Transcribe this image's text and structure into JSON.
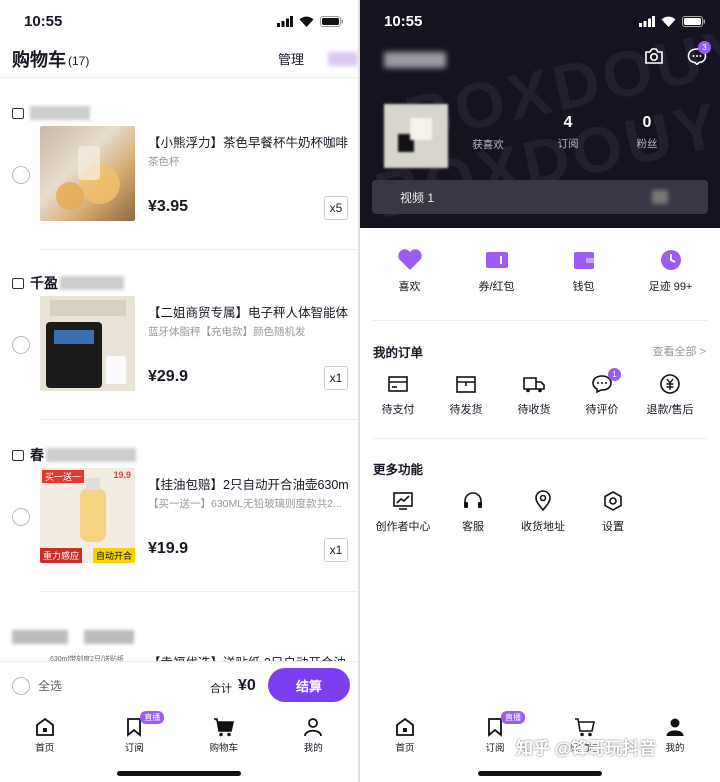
{
  "left": {
    "status": {
      "time": "10:55"
    },
    "header": {
      "title": "购物车",
      "count": "(17)",
      "manage": "管理"
    },
    "shops": [
      {
        "name": "",
        "items": [
          {
            "title": "【小熊浮力】茶色早餐杯牛奶杯咖啡",
            "spec": "茶色杯",
            "price": "¥3.95",
            "qty": "x5"
          }
        ]
      },
      {
        "name": "千盈",
        "items": [
          {
            "title": "【二姐商贸专属】电子秤人体智能体",
            "spec": "蓝牙体脂秤【充电款】颜色随机发",
            "price": "¥29.9",
            "qty": "x1"
          }
        ]
      },
      {
        "name": "春",
        "items": [
          {
            "title": "【挂油包赔】2只自动开合油壶630m",
            "spec": "【买一送一】630ML无铅玻璃则度款共2...",
            "price": "¥19.9",
            "qty": "x1",
            "img_labels": [
              "买一送一",
              "19.9",
              "重力感应",
              "自动开合"
            ]
          }
        ]
      },
      {
        "name": "",
        "items": [
          {
            "title": "【幸福优选】送贴纸 2只自动开合油",
            "img_label": "630ml带刻度2只/送贴纸"
          }
        ]
      }
    ],
    "checkout": {
      "select_all": "全选",
      "total_label": "合计",
      "total": "¥0",
      "pay": "结算"
    },
    "tabs": [
      {
        "label": "首页",
        "icon": "home-icon"
      },
      {
        "label": "订阅",
        "icon": "bookmark-icon",
        "badge": "直播"
      },
      {
        "label": "购物车",
        "icon": "cart-icon",
        "active": true
      },
      {
        "label": "我的",
        "icon": "person-icon"
      }
    ]
  },
  "right": {
    "status": {
      "time": "10:55"
    },
    "notif_badge": "3",
    "stats": [
      {
        "value": "",
        "label": "获喜欢"
      },
      {
        "value": "4",
        "label": "订阅"
      },
      {
        "value": "0",
        "label": "粉丝"
      }
    ],
    "video_bar": "视频 1",
    "watermark": "BOXDOUYINBOX",
    "quick": [
      {
        "label": "喜欢",
        "icon": "heart-icon"
      },
      {
        "label": "券/红包",
        "icon": "coupon-icon"
      },
      {
        "label": "钱包",
        "icon": "wallet-icon"
      },
      {
        "label": "足迹 99+",
        "icon": "clock-icon"
      }
    ],
    "orders": {
      "title": "我的订单",
      "view_all": "查看全部 >",
      "items": [
        {
          "label": "待支付",
          "icon": "card-icon"
        },
        {
          "label": "待发货",
          "icon": "box-icon"
        },
        {
          "label": "待收货",
          "icon": "truck-icon"
        },
        {
          "label": "待评价",
          "icon": "comment-icon",
          "badge": "1"
        },
        {
          "label": "退款/售后",
          "icon": "refund-icon"
        }
      ]
    },
    "more": {
      "title": "更多功能",
      "items": [
        {
          "label": "创作者中心",
          "icon": "chart-icon"
        },
        {
          "label": "客服",
          "icon": "headset-icon"
        },
        {
          "label": "收货地址",
          "icon": "location-icon"
        },
        {
          "label": "设置",
          "icon": "settings-icon"
        }
      ]
    },
    "tabs": [
      {
        "label": "首页",
        "icon": "home-icon"
      },
      {
        "label": "订阅",
        "icon": "bookmark-icon",
        "badge": "直播"
      },
      {
        "label": "购物车",
        "icon": "cart-icon"
      },
      {
        "label": "我的",
        "icon": "person-icon",
        "active": true
      }
    ],
    "zhihu_watermark": "知乎 @锋哥玩抖音"
  },
  "colors": {
    "accent": "#7a3ff0",
    "badge": "#9b5cf6",
    "dark_bg": "#15131f"
  }
}
